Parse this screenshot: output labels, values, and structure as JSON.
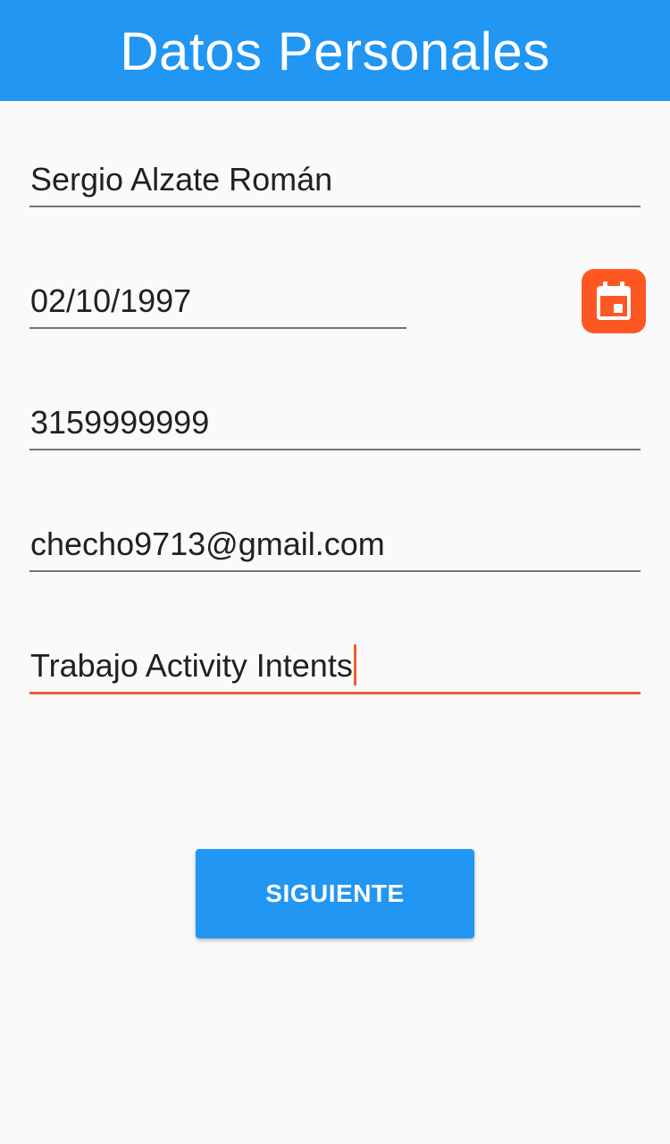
{
  "header": {
    "title": "Datos Personales",
    "color": "#2196f3"
  },
  "form": {
    "name": {
      "value": "Sergio Alzate Román"
    },
    "birthdate": {
      "value": "02/10/1997",
      "picker_icon": "calendar-icon"
    },
    "phone": {
      "value": "3159999999"
    },
    "email": {
      "value": "checho9713@gmail.com"
    },
    "notes": {
      "value": "Trabajo Activity Intents",
      "focused": true
    }
  },
  "actions": {
    "next_label": "SIGUIENTE"
  },
  "colors": {
    "primary": "#2196f3",
    "accent": "#ff5722",
    "focus_underline": "#e8602c",
    "background": "#fafafa"
  }
}
